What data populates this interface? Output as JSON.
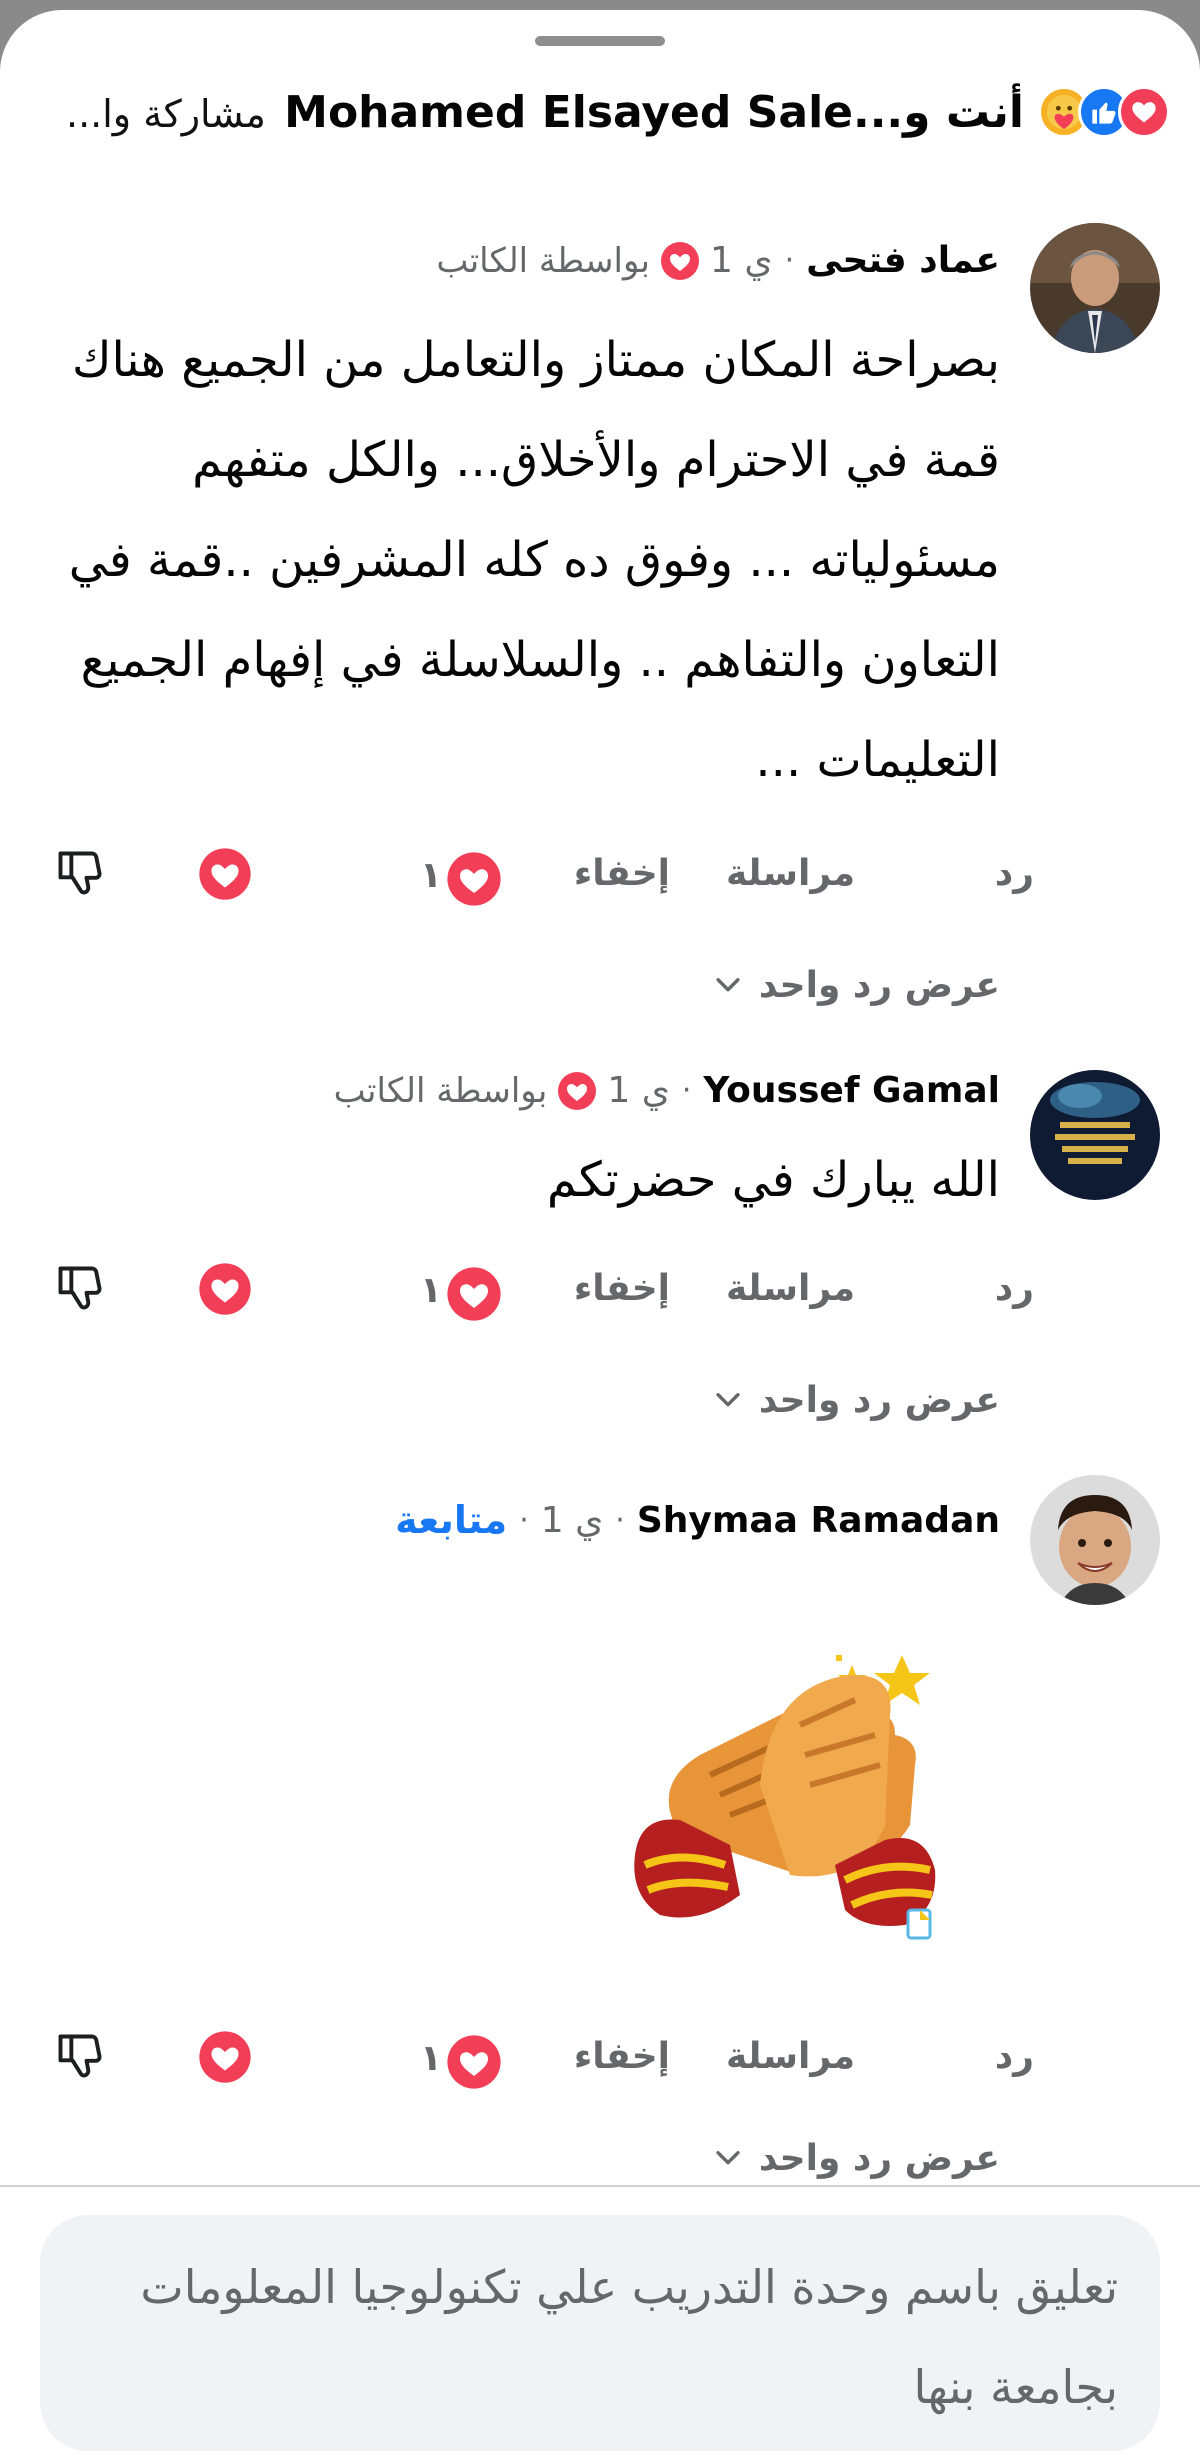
{
  "header": {
    "title": "أنت و...Mohamed Elsayed Sale",
    "share_label": "مشاركة وا...",
    "reaction_icons": [
      "love-icon",
      "like-icon",
      "care-icon"
    ]
  },
  "comments": [
    {
      "author": "عماد فتحى",
      "time": "1 ي",
      "badge": "بواسطة الكاتب",
      "text": "بصراحة المكان ممتاز والتعامل من الجميع هناك قمة في الاحترام والأخلاق... والكل متفهم مسئولياته ... وفوق ده كله المشرفين ..قمة في التعاون والتفاهم .. والسلاسلة في إفهام الجميع التعليمات ...",
      "actions": {
        "reply": "رد",
        "message": "مراسلة",
        "hide": "إخفاء",
        "reaction_count": "١"
      },
      "view_replies": "عرض رد واحد"
    },
    {
      "author": "Youssef Gamal",
      "time": "1 ي",
      "badge": "بواسطة الكاتب",
      "text": "الله يبارك في حضرتكم",
      "actions": {
        "reply": "رد",
        "message": "مراسلة",
        "hide": "إخفاء",
        "reaction_count": "١"
      },
      "view_replies": "عرض رد واحد"
    },
    {
      "author": "Shymaa Ramadan",
      "time": "1 ي",
      "follow": "متابعة",
      "sticker": "clapping-hands-sticker",
      "actions": {
        "reply": "رد",
        "message": "مراسلة",
        "hide": "إخفاء",
        "reaction_count": "١"
      },
      "view_replies": "عرض رد واحد"
    }
  ],
  "composer": {
    "placeholder": "تعليق باسم وحدة التدريب علي تكنولوجيا المعلومات بجامعة بنها"
  },
  "colors": {
    "love": "#f33e58",
    "like": "#1877f2",
    "care": "#f7b125",
    "follow": "#1877f2",
    "muted": "#65676b"
  }
}
